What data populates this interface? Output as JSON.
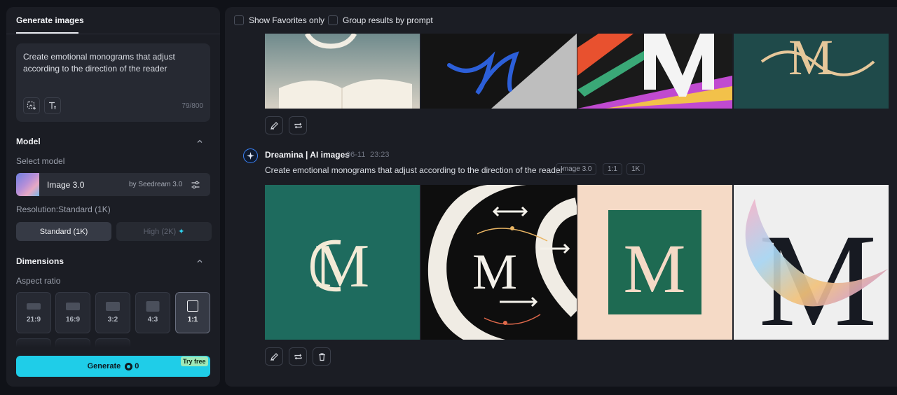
{
  "sidebar": {
    "tab_label": "Generate images",
    "prompt": {
      "text": "Create emotional monograms that adjust according to the direction of the reader",
      "count": "79/800",
      "buttons": [
        "add-image-icon",
        "text-format-icon"
      ]
    },
    "model": {
      "section_title": "Model",
      "select_label": "Select model",
      "name": "Image 3.0",
      "provider": "by Seedream 3.0"
    },
    "resolution": {
      "label": "Resolution:Standard (1K)",
      "standard_label": "Standard (1K)",
      "high_label": "High (2K)"
    },
    "dimensions": {
      "section_title": "Dimensions",
      "aspect_label": "Aspect ratio",
      "ratios": [
        {
          "label": "21:9",
          "selected": false
        },
        {
          "label": "16:9",
          "selected": false
        },
        {
          "label": "3:2",
          "selected": false
        },
        {
          "label": "4:3",
          "selected": false
        },
        {
          "label": "1:1",
          "selected": true
        }
      ]
    },
    "generate": {
      "label": "Generate",
      "cost": "0",
      "badge": "Try free"
    }
  },
  "main": {
    "filters": {
      "favorites_label": "Show Favorites only",
      "group_label": "Group results by prompt"
    },
    "generation": {
      "author": "Dreamina | AI images",
      "date": "06-11",
      "time": "23:23",
      "prompt": "Create emotional monograms that adjust according to the direction of the reader",
      "tags": [
        "Image 3.0",
        "1:1",
        "1K"
      ]
    }
  },
  "colors": {
    "accent": "#1fcde8",
    "panel": "#1b1d24",
    "background": "#101218"
  }
}
